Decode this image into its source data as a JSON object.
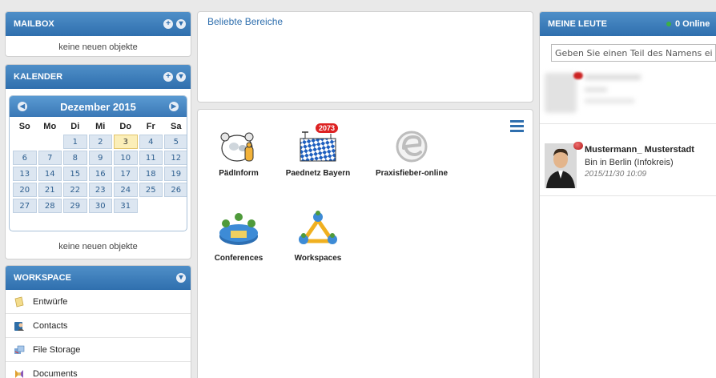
{
  "mailbox": {
    "title": "MAILBOX",
    "empty": "keine neuen objekte"
  },
  "calendar": {
    "title": "KALENDER",
    "month": "Dezember 2015",
    "weekdays": [
      "So",
      "Mo",
      "Di",
      "Mi",
      "Do",
      "Fr",
      "Sa"
    ],
    "weeks": [
      [
        "",
        "",
        "1",
        "2",
        "3",
        "4",
        "5"
      ],
      [
        "6",
        "7",
        "8",
        "9",
        "10",
        "11",
        "12"
      ],
      [
        "13",
        "14",
        "15",
        "16",
        "17",
        "18",
        "19"
      ],
      [
        "20",
        "21",
        "22",
        "23",
        "24",
        "25",
        "26"
      ],
      [
        "27",
        "28",
        "29",
        "30",
        "31",
        "",
        ""
      ]
    ],
    "today": "3",
    "empty": "keine neuen objekte"
  },
  "workspace": {
    "title": "WORKSPACE",
    "items": [
      {
        "label": "Entwürfe",
        "icon": "drafts-icon"
      },
      {
        "label": "Contacts",
        "icon": "contacts-icon"
      },
      {
        "label": "File Storage",
        "icon": "file-storage-icon"
      },
      {
        "label": "Documents",
        "icon": "documents-icon"
      }
    ]
  },
  "favorites": {
    "title": "Beliebte Bereiche"
  },
  "apps": {
    "items": [
      {
        "label": "PädInform",
        "icon": "paedinform-icon"
      },
      {
        "label": "Paednetz Bayern",
        "icon": "paednetz-bayern-icon",
        "badge": "2073"
      },
      {
        "label": "Praxisfieber-online",
        "icon": "praxisfieber-icon"
      },
      {
        "label": "Conferences",
        "icon": "conferences-icon"
      },
      {
        "label": "Workspaces",
        "icon": "workspaces-icon"
      }
    ]
  },
  "people": {
    "title": "MEINE LEUTE",
    "online": "0 Online",
    "search_placeholder": "Geben Sie einen Teil des Namens ein",
    "contact": {
      "name": "Mustermann_ Musterstadt",
      "status": "Bin in Berlin (Infokreis)",
      "time": "2015/11/30 10:09"
    }
  },
  "colors": {
    "header_blue": "#2f6fae",
    "menu_blue": "#2f6fae",
    "badge_red": "#dd2222",
    "online_green": "#3cb043"
  }
}
